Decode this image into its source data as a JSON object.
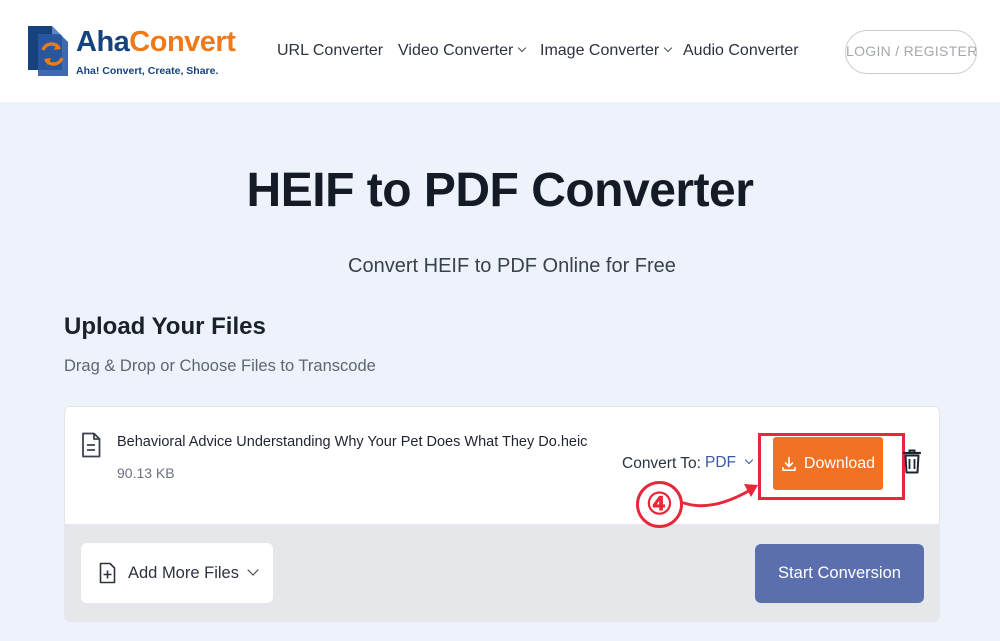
{
  "brand": {
    "name_part1": "Aha",
    "name_part2": "Convert",
    "tagline": "Aha! Convert, Create, Share."
  },
  "nav": {
    "items": [
      {
        "label": "URL Converter",
        "has_dropdown": false
      },
      {
        "label": "Video Converter",
        "has_dropdown": true
      },
      {
        "label": "Image Converter",
        "has_dropdown": true
      },
      {
        "label": "Audio Converter",
        "has_dropdown": false
      }
    ],
    "login_label": "LOGIN / REGISTER"
  },
  "hero": {
    "title": "HEIF to PDF Converter",
    "subtitle": "Convert HEIF to PDF Online for Free"
  },
  "upload": {
    "title": "Upload Your Files",
    "subtitle": "Drag & Drop or Choose Files to Transcode",
    "file": {
      "name": "Behavioral Advice Understanding Why Your Pet Does What They Do.heic",
      "size": "90.13 KB",
      "convert_to_label": "Convert To:",
      "format": "PDF",
      "download_label": "Download"
    },
    "add_more_label": "Add More Files",
    "start_label": "Start Conversion"
  },
  "annotation": {
    "step": "④"
  },
  "colors": {
    "brand_blue": "#16437e",
    "brand_orange": "#ef7a1a",
    "download_orange": "#f07222",
    "start_button": "#5b6fae",
    "highlight_red": "#e8283a",
    "format_blue": "#3c56a8"
  },
  "icons": [
    "logo-icon",
    "chevron-down-icon",
    "file-icon",
    "download-icon",
    "trash-icon",
    "add-file-icon",
    "arrow-icon"
  ]
}
